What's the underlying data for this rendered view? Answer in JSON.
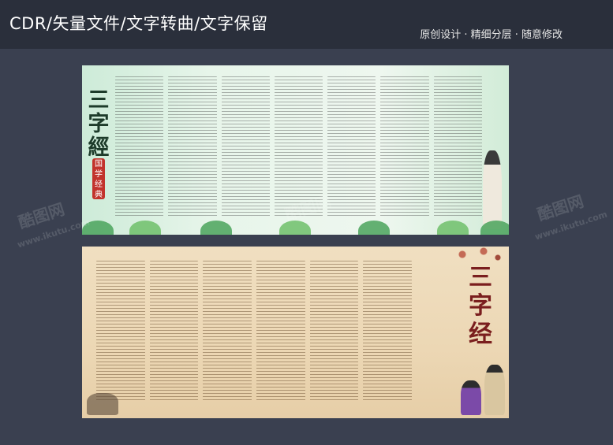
{
  "header": {
    "title": "CDR/矢量文件/文字转曲/文字保留",
    "subtitle": "原创设计 · 精细分层 · 随意修改"
  },
  "panel_green": {
    "title": "三字經",
    "seal": "国学经典"
  },
  "panel_beige": {
    "title": "三字经"
  },
  "watermark": {
    "brand": "酷图网",
    "url": "www.ikutu.com"
  }
}
